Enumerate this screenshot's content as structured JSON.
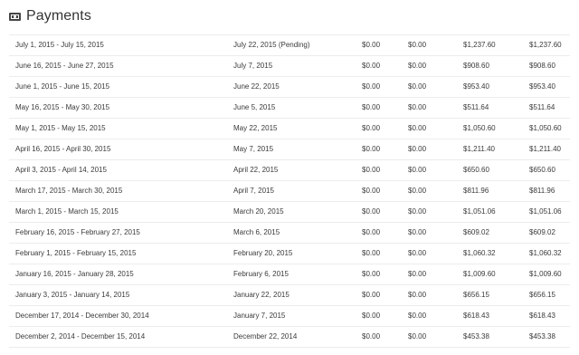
{
  "header": {
    "title": "Payments",
    "icon": "money-icon"
  },
  "rows": [
    {
      "period": "July 1, 2015 - July 15, 2015",
      "pay_date": "July 22, 2015 (Pending)",
      "col_a": "$0.00",
      "col_b": "$0.00",
      "col_c": "$1,237.60",
      "col_d": "$1,237.60"
    },
    {
      "period": "June 16, 2015 - June 27, 2015",
      "pay_date": "July 7, 2015",
      "col_a": "$0.00",
      "col_b": "$0.00",
      "col_c": "$908.60",
      "col_d": "$908.60"
    },
    {
      "period": "June 1, 2015 - June 15, 2015",
      "pay_date": "June 22, 2015",
      "col_a": "$0.00",
      "col_b": "$0.00",
      "col_c": "$953.40",
      "col_d": "$953.40"
    },
    {
      "period": "May 16, 2015 - May 30, 2015",
      "pay_date": "June 5, 2015",
      "col_a": "$0.00",
      "col_b": "$0.00",
      "col_c": "$511.64",
      "col_d": "$511.64"
    },
    {
      "period": "May 1, 2015 - May 15, 2015",
      "pay_date": "May 22, 2015",
      "col_a": "$0.00",
      "col_b": "$0.00",
      "col_c": "$1,050.60",
      "col_d": "$1,050.60"
    },
    {
      "period": "April 16, 2015 - April 30, 2015",
      "pay_date": "May 7, 2015",
      "col_a": "$0.00",
      "col_b": "$0.00",
      "col_c": "$1,211.40",
      "col_d": "$1,211.40"
    },
    {
      "period": "April 3, 2015 - April 14, 2015",
      "pay_date": "April 22, 2015",
      "col_a": "$0.00",
      "col_b": "$0.00",
      "col_c": "$650.60",
      "col_d": "$650.60"
    },
    {
      "period": "March 17, 2015 - March 30, 2015",
      "pay_date": "April 7, 2015",
      "col_a": "$0.00",
      "col_b": "$0.00",
      "col_c": "$811.96",
      "col_d": "$811.96"
    },
    {
      "period": "March 1, 2015 - March 15, 2015",
      "pay_date": "March 20, 2015",
      "col_a": "$0.00",
      "col_b": "$0.00",
      "col_c": "$1,051.06",
      "col_d": "$1,051.06"
    },
    {
      "period": "February 16, 2015 - February 27, 2015",
      "pay_date": "March 6, 2015",
      "col_a": "$0.00",
      "col_b": "$0.00",
      "col_c": "$609.02",
      "col_d": "$609.02"
    },
    {
      "period": "February 1, 2015 - February 15, 2015",
      "pay_date": "February 20, 2015",
      "col_a": "$0.00",
      "col_b": "$0.00",
      "col_c": "$1,060.32",
      "col_d": "$1,060.32"
    },
    {
      "period": "January 16, 2015 - January 28, 2015",
      "pay_date": "February 6, 2015",
      "col_a": "$0.00",
      "col_b": "$0.00",
      "col_c": "$1,009.60",
      "col_d": "$1,009.60"
    },
    {
      "period": "January 3, 2015 - January 14, 2015",
      "pay_date": "January 22, 2015",
      "col_a": "$0.00",
      "col_b": "$0.00",
      "col_c": "$656.15",
      "col_d": "$656.15"
    },
    {
      "period": "December 17, 2014 - December 30, 2014",
      "pay_date": "January 7, 2015",
      "col_a": "$0.00",
      "col_b": "$0.00",
      "col_c": "$618.43",
      "col_d": "$618.43"
    },
    {
      "period": "December 2, 2014 - December 15, 2014",
      "pay_date": "December 22, 2014",
      "col_a": "$0.00",
      "col_b": "$0.00",
      "col_c": "$453.38",
      "col_d": "$453.38"
    }
  ]
}
